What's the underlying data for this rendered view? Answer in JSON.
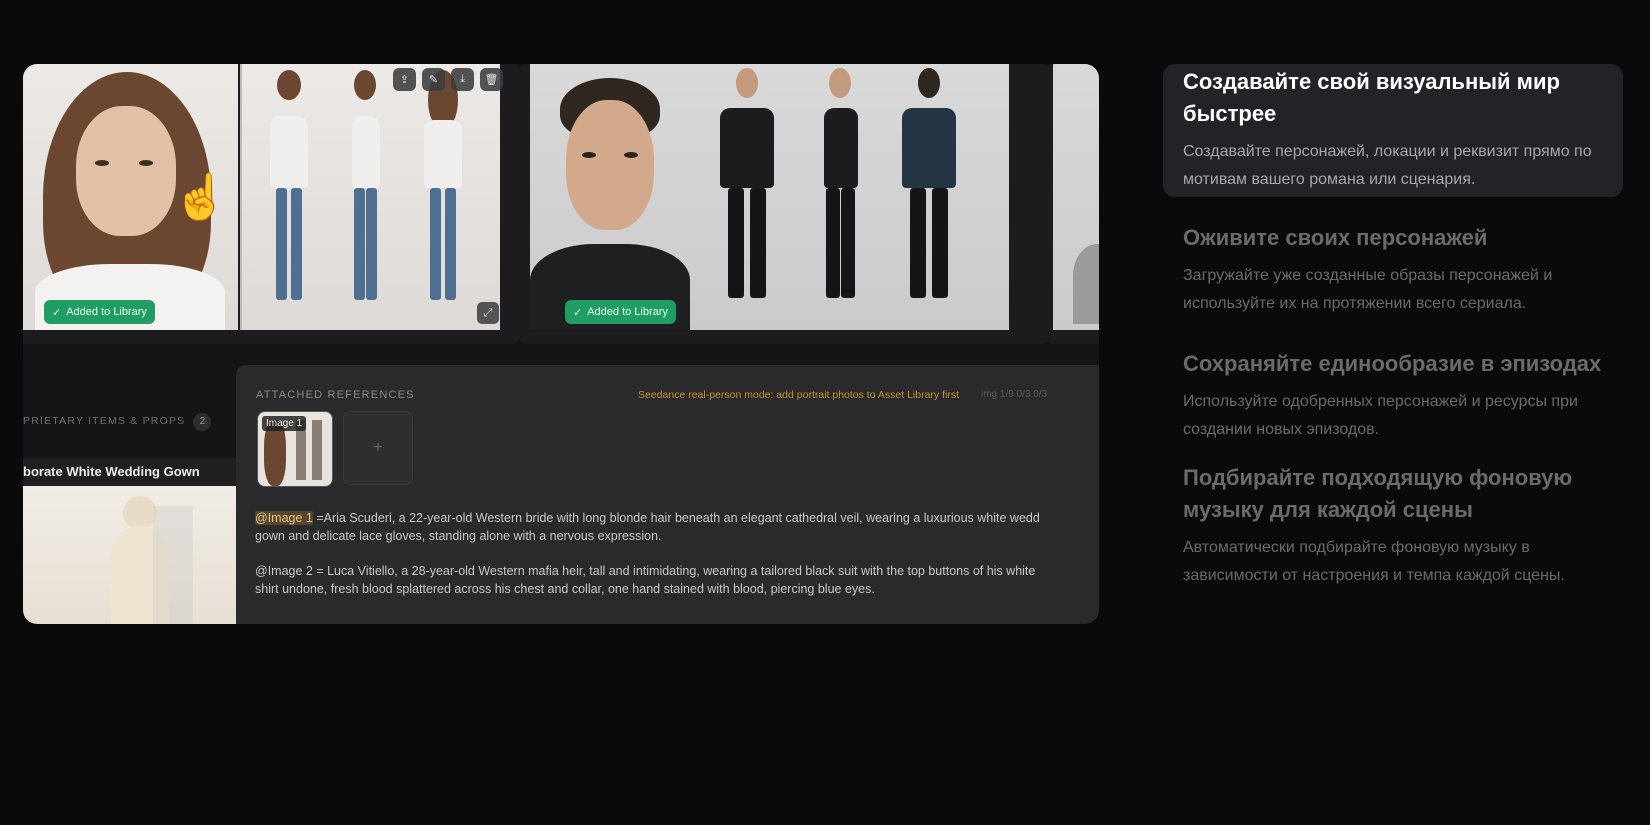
{
  "preview": {
    "card1": {
      "badge": "Added to Library",
      "toolbar_icons": [
        "share-icon",
        "pencil-icon",
        "download-icon",
        "trash-icon"
      ]
    },
    "card2": {
      "badge": "Added to Library"
    },
    "props": {
      "label": "PRIETARY ITEMS & PROPS",
      "count": "2",
      "item_title": "borate White Wedding Gown"
    },
    "references": {
      "label": "ATTACHED REFERENCES",
      "warning": "Seedance real-person mode: add portrait photos to Asset Library first",
      "meta": "img 1/9   0/3   0/3",
      "thumb_badge": "Image 1",
      "add_symbol": "+"
    },
    "prompt": {
      "p1_tag": "@Image 1",
      "p1_line1": " =Aria Scuderi, a 22-year-old Western bride with long blonde hair beneath an elegant cathedral veil, wearing a luxurious white wedd",
      "p1_line2": "gown and delicate lace gloves, standing alone with a nervous expression.",
      "p2_line1": "@Image 2 = Luca Vitiello, a 28-year-old Western mafia heir, tall and intimidating, wearing a tailored black suit with the top buttons of his white",
      "p2_line2": "shirt undone, fresh blood splattered across his chest and collar, one hand stained with blood, piercing blue eyes."
    }
  },
  "features": [
    {
      "title": "Создавайте свой визуальный мир быстрее",
      "description": "Создавайте персонажей, локации и реквизит прямо по мотивам вашего романа или сценария."
    },
    {
      "title": "Оживите своих персонажей",
      "description": "Загружайте уже созданные образы персонажей и используйте их на протяжении всего сериала."
    },
    {
      "title": "Сохраняйте единообразие в эпизодах",
      "description": "Используйте одобренных персонажей и ресурсы при создании новых эпизодов."
    },
    {
      "title": "Подбирайте подходящую фоновую музыку для каждой сцены",
      "description": "Автоматически подбирайте фоновую музыку в зависимости от настроения и темпа каждой сцены."
    }
  ],
  "colors": {
    "page_bg": "#0a0a0b",
    "active_card_bg": "#232327",
    "badge_green": "#1f9d63",
    "warning_orange": "#c9922e"
  }
}
